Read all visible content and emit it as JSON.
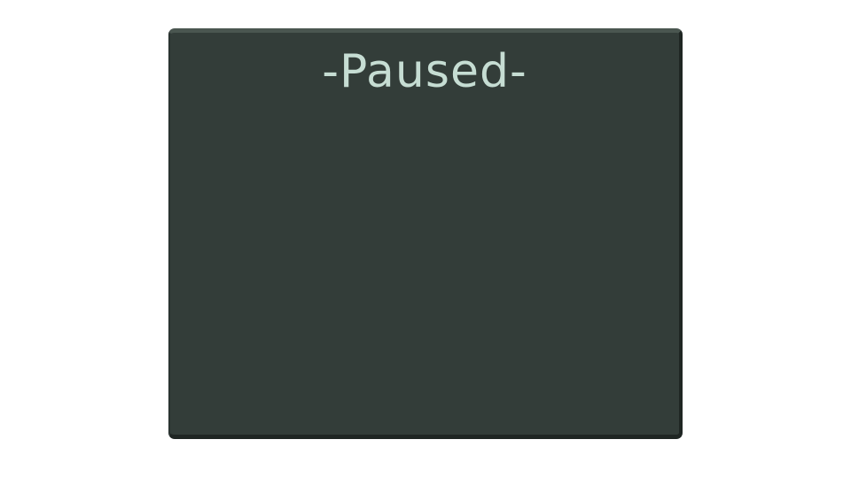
{
  "pause_menu": {
    "title": "-Paused-"
  },
  "colors": {
    "panel_background": "#333d39",
    "panel_border_light": "#4a5650",
    "panel_border_dark": "#1f2623",
    "title_text": "#c6ddd3",
    "page_background": "#ffffff"
  }
}
